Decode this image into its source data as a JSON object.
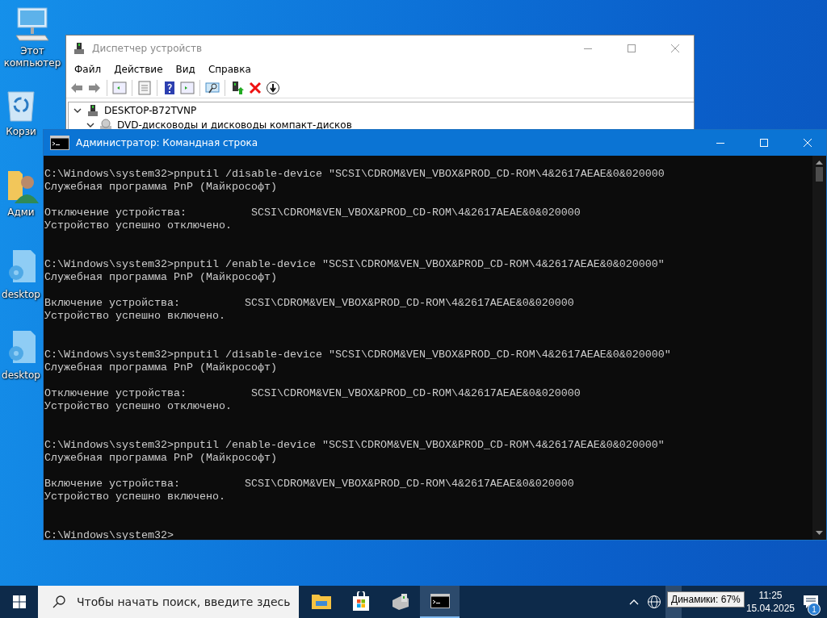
{
  "desktop_icons": [
    {
      "label": "Этот компьютер",
      "kind": "computer"
    },
    {
      "label": "Корзи",
      "kind": "recycle"
    },
    {
      "label": "Адми",
      "kind": "user_folder"
    },
    {
      "label": "desktop",
      "kind": "settings_file"
    },
    {
      "label": "desktop",
      "kind": "settings_file"
    }
  ],
  "device_manager": {
    "title": "Диспетчер устройств",
    "menu": [
      "Файл",
      "Действие",
      "Вид",
      "Справка"
    ],
    "tree": [
      {
        "label": "DESKTOP-B72TVNP",
        "kind": "computer",
        "expanded": true,
        "children": [
          {
            "label": "DVD-дисководы и дисководы компакт-дисков",
            "kind": "dvd",
            "expanded": true
          }
        ]
      }
    ]
  },
  "console": {
    "title": "Администратор: Командная строка",
    "sessions": [
      {
        "input": "C:\\Windows\\system32>pnputil /disable-device \"SCSI\\CDROM&VEN_VBOX&PROD_CD-ROM\\4&2617AEAE&0&020000",
        "header": "Служебная программа PnP (Майкрософт)",
        "result": [
          "Отключение устройства:          SCSI\\CDROM&VEN_VBOX&PROD_CD-ROM\\4&2617AEAE&0&020000",
          "Устройство успешно отключено."
        ]
      },
      {
        "input": "C:\\Windows\\system32>pnputil /enable-device \"SCSI\\CDROM&VEN_VBOX&PROD_CD-ROM\\4&2617AEAE&0&020000\"",
        "header": "Служебная программа PnP (Майкрософт)",
        "result": [
          "Включение устройства:          SCSI\\CDROM&VEN_VBOX&PROD_CD-ROM\\4&2617AEAE&0&020000",
          "Устройство успешно включено."
        ]
      },
      {
        "input": "C:\\Windows\\system32>pnputil /disable-device \"SCSI\\CDROM&VEN_VBOX&PROD_CD-ROM\\4&2617AEAE&0&020000\"",
        "header": "Служебная программа PnP (Майкрософт)",
        "result": [
          "Отключение устройства:          SCSI\\CDROM&VEN_VBOX&PROD_CD-ROM\\4&2617AEAE&0&020000",
          "Устройство успешно отключено."
        ]
      },
      {
        "input": "C:\\Windows\\system32>pnputil /enable-device \"SCSI\\CDROM&VEN_VBOX&PROD_CD-ROM\\4&2617AEAE&0&020000\"",
        "header": "Служебная программа PnP (Майкрософт)",
        "result": [
          "Включение устройства:          SCSI\\CDROM&VEN_VBOX&PROD_CD-ROM\\4&2617AEAE&0&020000",
          "Устройство успешно включено."
        ]
      }
    ],
    "prompt": "C:\\Windows\\system32>"
  },
  "taskbar": {
    "search": {
      "placeholder": "Чтобы начать поиск, введите здесь"
    },
    "apps": [
      {
        "kind": "explorer",
        "selected": false
      },
      {
        "kind": "store",
        "selected": false
      },
      {
        "kind": "device_manager",
        "selected": false
      },
      {
        "kind": "cmd",
        "selected": true
      }
    ],
    "tooltip": "Динамики: 67%",
    "time": "11:25",
    "date": "15.04.2025",
    "notifications": "1"
  }
}
